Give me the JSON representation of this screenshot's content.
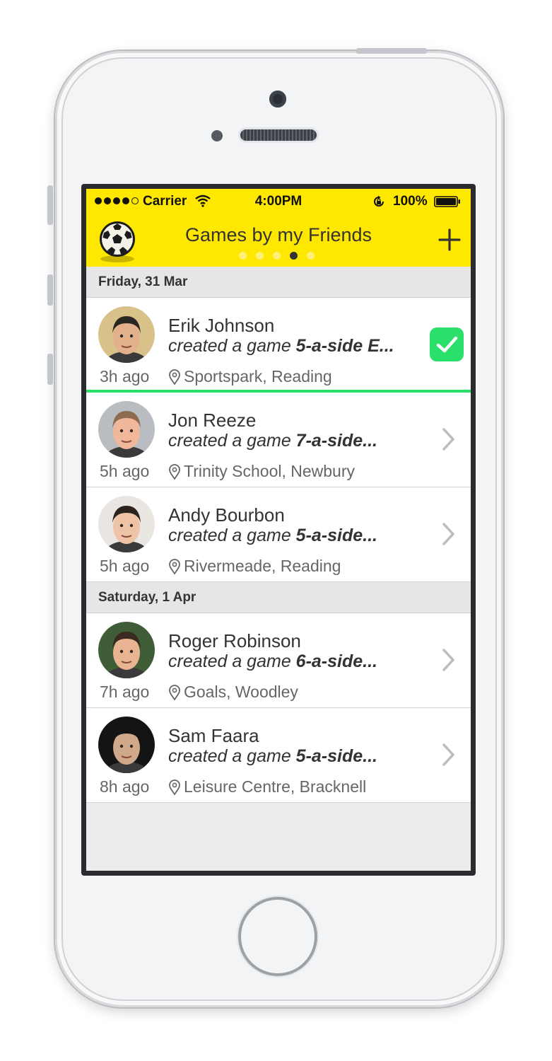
{
  "status_bar": {
    "carrier": "Carrier",
    "time": "4:00PM",
    "battery": "100%",
    "signal_bars": [
      true,
      true,
      true,
      true,
      false
    ]
  },
  "nav": {
    "logo_icon": "soccer-ball-icon",
    "title": "Games by my Friends",
    "page_count": 5,
    "active_page": 4,
    "add_icon": "plus-icon"
  },
  "colors": {
    "brand_yellow": "#ffe800",
    "accent_green": "#2adf6a"
  },
  "sections": [
    {
      "header": "Friday, 31 Mar",
      "items": [
        {
          "name": "Erik Johnson",
          "action": "created a game ",
          "game": "5-a-side E...",
          "time": "3h ago",
          "location": "Sportspark, Reading",
          "status_icon": "checkmark-icon",
          "avatar_colors": [
            "#d9c28a",
            "#2a2622",
            "#e2b08b"
          ]
        },
        {
          "name": "Jon Reeze",
          "action": "created a game ",
          "game": "7-a-side...",
          "time": "5h ago",
          "location": "Trinity School, Newbury",
          "status_icon": "chevron-right-icon",
          "avatar_colors": [
            "#b9bcc0",
            "#8c6b4f",
            "#f0b79a"
          ]
        },
        {
          "name": "Andy Bourbon",
          "action": "created a game ",
          "game": "5-a-side...",
          "time": "5h ago",
          "location": "Rivermeade, Reading",
          "status_icon": "chevron-right-icon",
          "avatar_colors": [
            "#e9e5e1",
            "#2b211d",
            "#efc4a6"
          ]
        }
      ]
    },
    {
      "header": "Saturday, 1 Apr",
      "items": [
        {
          "name": "Roger Robinson",
          "action": "created a game ",
          "game": "6-a-side...",
          "time": "7h ago",
          "location": "Goals, Woodley",
          "status_icon": "chevron-right-icon",
          "avatar_colors": [
            "#3f5d36",
            "#3a2a21",
            "#e8b491"
          ]
        },
        {
          "name": "Sam Faara",
          "action": "created a game ",
          "game": "5-a-side...",
          "time": "8h ago",
          "location": "Leisure Centre, Bracknell",
          "status_icon": "chevron-right-icon",
          "avatar_colors": [
            "#141414",
            "#141414",
            "#cfa98a"
          ]
        }
      ]
    }
  ]
}
